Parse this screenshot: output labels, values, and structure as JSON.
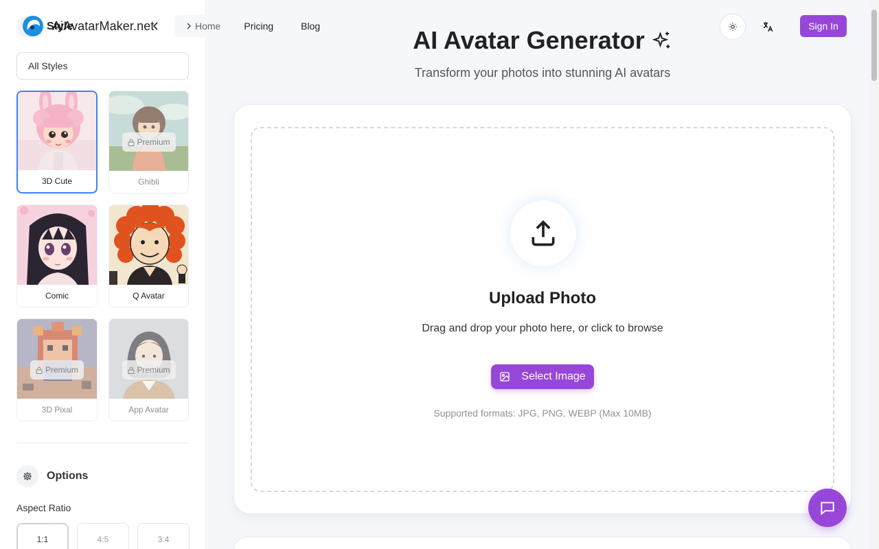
{
  "brand": {
    "name": "AiAvatarMaker.net"
  },
  "nav": {
    "items": [
      {
        "label": "Home"
      },
      {
        "label": "Pricing"
      },
      {
        "label": "Blog"
      }
    ]
  },
  "header": {
    "sign_in_label": "Sign In",
    "theme_icon": "sun-icon",
    "language_icon": "translate-icon"
  },
  "sidebar": {
    "title": "Style",
    "style_select": {
      "value": "All Styles"
    },
    "styles": [
      {
        "label": "3D Cute",
        "selected": true,
        "locked": false
      },
      {
        "label": "Ghibli",
        "selected": false,
        "locked": true,
        "badge": "Premium"
      },
      {
        "label": "Comic",
        "selected": false,
        "locked": false
      },
      {
        "label": "Q Avatar",
        "selected": false,
        "locked": false
      },
      {
        "label": "3D Pixal",
        "selected": false,
        "locked": true,
        "badge": "Premium"
      },
      {
        "label": "App Avatar",
        "selected": false,
        "locked": true,
        "badge": "Premium"
      }
    ],
    "options_title": "Options",
    "aspect_label": "Aspect Ratio",
    "ratios": [
      {
        "label": "1:1",
        "active": true
      },
      {
        "label": "4:5",
        "active": false
      },
      {
        "label": "3:4",
        "active": false
      }
    ]
  },
  "main": {
    "title": "AI Avatar Generator",
    "subtitle": "Transform your photos into stunning AI avatars",
    "upload": {
      "title": "Upload Photo",
      "description": "Drag and drop your photo here, or click to browse",
      "button_label": "Select Image",
      "formats": "Supported formats: JPG, PNG, WEBP (Max 10MB)"
    }
  },
  "colors": {
    "accent": "#9747d8",
    "selected_border": "#3b82f6"
  }
}
